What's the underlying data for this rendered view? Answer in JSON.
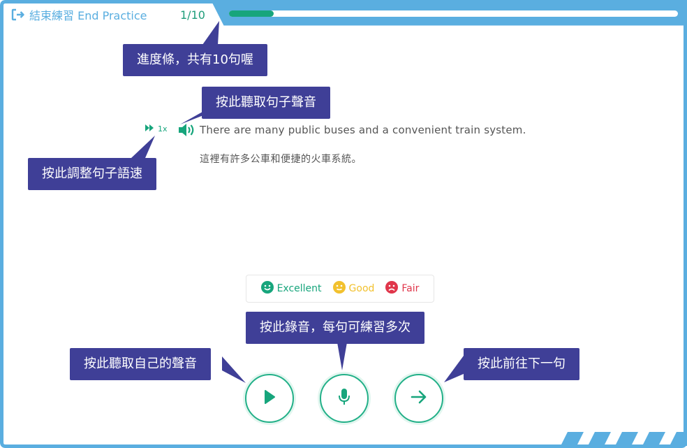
{
  "header": {
    "end_label": "結束練習 End Practice",
    "counter": "1/10",
    "progress_fraction": 0.1
  },
  "tips": {
    "progress": "進度條，共有10句喔",
    "listen_sentence": "按此聽取句子聲音",
    "speed": "按此調整句子語速",
    "record": "按此錄音，每句可練習多次",
    "playback": "按此聽取自己的聲音",
    "next": "按此前往下一句"
  },
  "sentence": {
    "speed_label": "1x",
    "english": "There are many public buses and a convenient train system.",
    "chinese": "這裡有許多公車和便捷的火車系統。"
  },
  "legend": {
    "excellent": "Excellent",
    "good": "Good",
    "fair": "Fair"
  },
  "colors": {
    "frame": "#5aaee0",
    "accent": "#17a57c",
    "tooltip": "#3f3f97",
    "excellent": "#17a57c",
    "good": "#f2c12e",
    "fair": "#e0364b"
  },
  "icons": {
    "end": "exit-arrow-icon",
    "speed": "fast-forward-icon",
    "speaker": "speaker-icon",
    "play": "play-icon",
    "mic": "microphone-icon",
    "next": "arrow-right-icon"
  }
}
